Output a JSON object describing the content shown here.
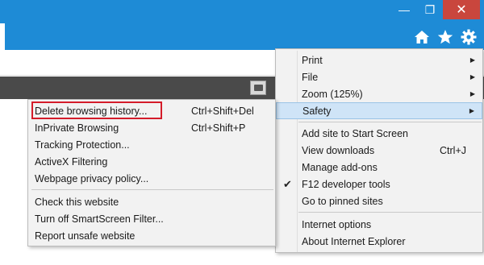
{
  "window": {
    "minimize_glyph": "—",
    "maximize_glyph": "❐",
    "close_glyph": "✕"
  },
  "toolbar": {
    "icons": [
      "home-icon",
      "favorites-star-icon",
      "tools-gear-icon"
    ]
  },
  "colors": {
    "chrome_blue": "#1e8bd6",
    "close_red": "#c9463d",
    "highlight": "#cfe4f7",
    "annotation_red": "#d41c2a"
  },
  "tools_menu": {
    "items": [
      {
        "label": "Print",
        "submenu": true
      },
      {
        "label": "File",
        "submenu": true
      },
      {
        "label": "Zoom (125%)",
        "submenu": true
      },
      {
        "label": "Safety",
        "submenu": true,
        "active": true
      },
      {
        "label": "Add site to Start Screen"
      },
      {
        "label": "View downloads",
        "shortcut": "Ctrl+J"
      },
      {
        "label": "Manage add-ons"
      },
      {
        "label": "F12 developer tools",
        "checked": true
      },
      {
        "label": "Go to pinned sites"
      },
      {
        "label": "Internet options"
      },
      {
        "label": "About Internet Explorer"
      }
    ],
    "arrow_glyph": "▶",
    "check_glyph": "✔"
  },
  "safety_submenu": {
    "items": [
      {
        "label": "Delete browsing history...",
        "shortcut": "Ctrl+Shift+Del",
        "annotated": true
      },
      {
        "label": "InPrivate Browsing",
        "shortcut": "Ctrl+Shift+P"
      },
      {
        "label": "Tracking Protection..."
      },
      {
        "label": "ActiveX Filtering"
      },
      {
        "label": "Webpage privacy policy..."
      },
      {
        "label": "Check this website"
      },
      {
        "label": "Turn off SmartScreen Filter..."
      },
      {
        "label": "Report unsafe website"
      }
    ]
  }
}
